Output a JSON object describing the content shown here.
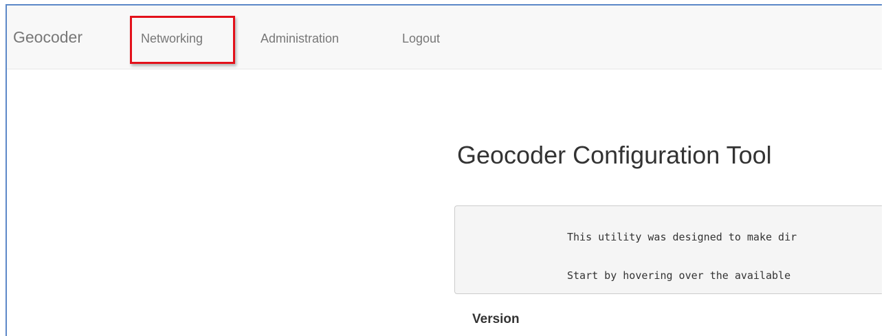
{
  "navbar": {
    "brand": "Geocoder",
    "items": [
      {
        "label": "Networking",
        "highlighted": true
      },
      {
        "label": "Administration"
      },
      {
        "label": "Logout"
      }
    ]
  },
  "main": {
    "title": "Geocoder Configuration Tool",
    "info_lines": [
      "This utility was designed to make dir",
      "Start by hovering over the available "
    ],
    "version_label": "Version"
  },
  "colors": {
    "frame_border": "#5b87c7",
    "highlight": "#e3101a",
    "navbar_bg": "#f8f8f8",
    "nav_text": "#777777",
    "info_bg": "#f5f5f5"
  }
}
